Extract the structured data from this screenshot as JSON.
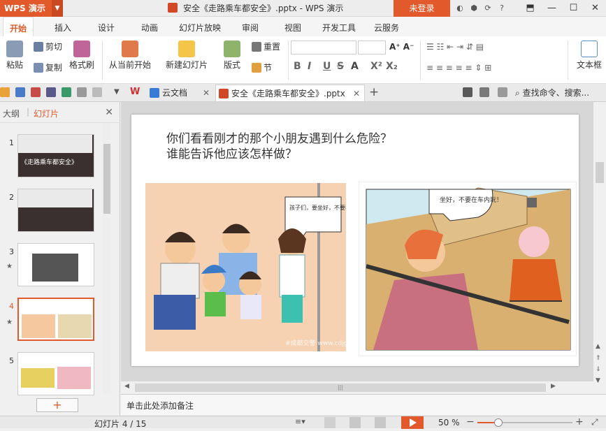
{
  "app": {
    "logo": "WPS 演示",
    "title": "安全《走路乘车都安全》.pptx - WPS 演示",
    "login": "未登录"
  },
  "menu": [
    "开始",
    "插入",
    "设计",
    "动画",
    "幻灯片放映",
    "审阅",
    "视图",
    "开发工具",
    "云服务"
  ],
  "ribbon": {
    "paste": "粘贴",
    "cut": "剪切",
    "copy": "复制",
    "format_painter": "格式刷",
    "from_current": "从当前开始",
    "new_slide": "新建幻灯片",
    "layout": "版式",
    "reset": "重置",
    "section": "节",
    "textbox": "文本框"
  },
  "doc_tabs": [
    {
      "label": "云文档"
    },
    {
      "label": "安全《走路乘车都安全》.pptx"
    }
  ],
  "search_cmd": "查找命令、搜索...",
  "left_panel": {
    "tab_outline": "大纲",
    "tab_slides": "幻灯片"
  },
  "thumbs": [
    {
      "num": "1",
      "title": "《走路乘车都安全》"
    },
    {
      "num": "2",
      "title": ""
    },
    {
      "num": "3",
      "title": ""
    },
    {
      "num": "4",
      "title": ""
    },
    {
      "num": "5",
      "title": ""
    }
  ],
  "slide": {
    "line1": "你们看看刚才的那个小朋友遇到什么危险？",
    "line2": "谁能告诉他应该怎样做？",
    "bubble1": "孩子们，要坐好，不要打闹。",
    "bubble2": "坐好，不要在车内玩！",
    "watermark": "#成都交警 www.cdjg.gov.cn"
  },
  "notes_placeholder": "单击此处添加备注",
  "status": {
    "slide_counter": "幻灯片 4 / 15",
    "zoom": "50 %"
  },
  "colors": {
    "accent": "#e25a2b"
  }
}
